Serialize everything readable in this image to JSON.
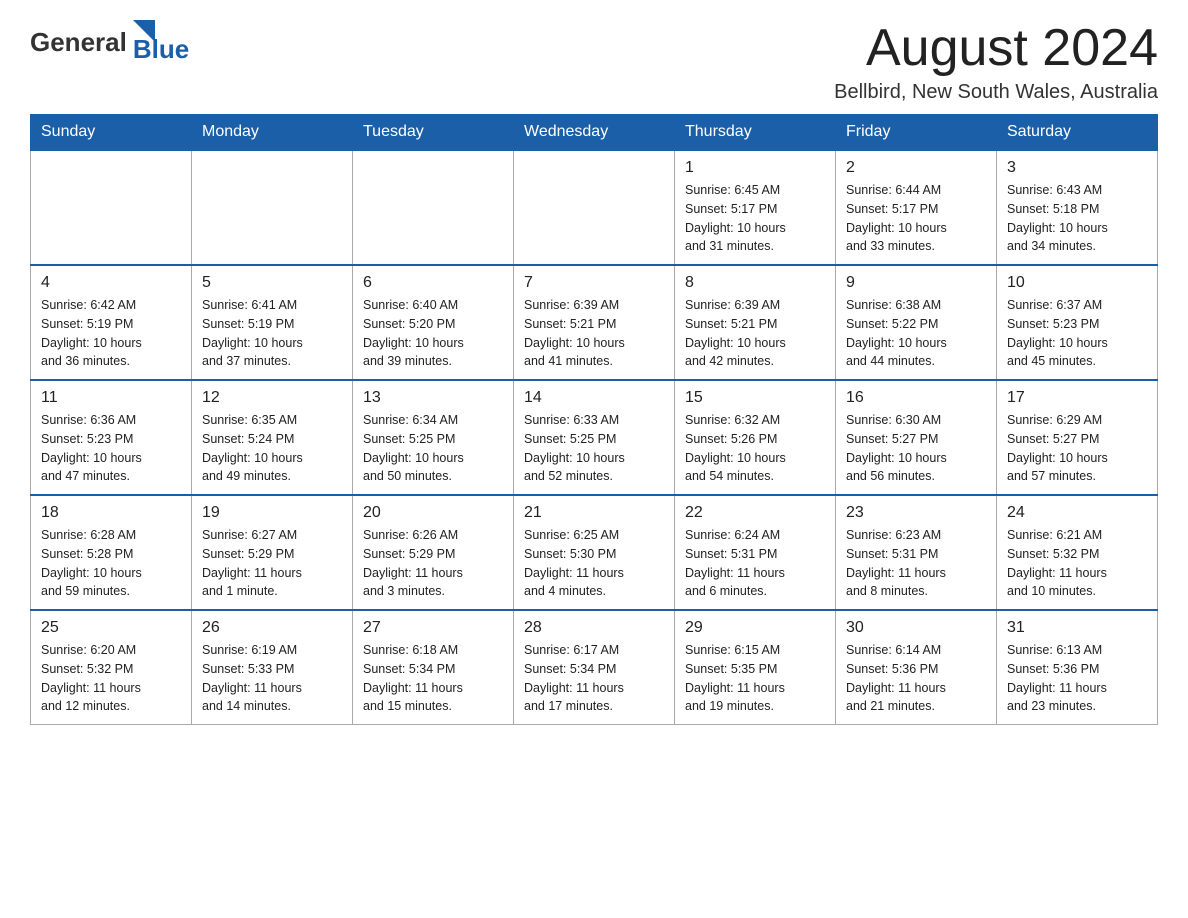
{
  "header": {
    "logo_general": "General",
    "logo_blue": "Blue",
    "month_title": "August 2024",
    "location": "Bellbird, New South Wales, Australia"
  },
  "weekdays": [
    "Sunday",
    "Monday",
    "Tuesday",
    "Wednesday",
    "Thursday",
    "Friday",
    "Saturday"
  ],
  "weeks": [
    [
      {
        "day": "",
        "info": ""
      },
      {
        "day": "",
        "info": ""
      },
      {
        "day": "",
        "info": ""
      },
      {
        "day": "",
        "info": ""
      },
      {
        "day": "1",
        "info": "Sunrise: 6:45 AM\nSunset: 5:17 PM\nDaylight: 10 hours\nand 31 minutes."
      },
      {
        "day": "2",
        "info": "Sunrise: 6:44 AM\nSunset: 5:17 PM\nDaylight: 10 hours\nand 33 minutes."
      },
      {
        "day": "3",
        "info": "Sunrise: 6:43 AM\nSunset: 5:18 PM\nDaylight: 10 hours\nand 34 minutes."
      }
    ],
    [
      {
        "day": "4",
        "info": "Sunrise: 6:42 AM\nSunset: 5:19 PM\nDaylight: 10 hours\nand 36 minutes."
      },
      {
        "day": "5",
        "info": "Sunrise: 6:41 AM\nSunset: 5:19 PM\nDaylight: 10 hours\nand 37 minutes."
      },
      {
        "day": "6",
        "info": "Sunrise: 6:40 AM\nSunset: 5:20 PM\nDaylight: 10 hours\nand 39 minutes."
      },
      {
        "day": "7",
        "info": "Sunrise: 6:39 AM\nSunset: 5:21 PM\nDaylight: 10 hours\nand 41 minutes."
      },
      {
        "day": "8",
        "info": "Sunrise: 6:39 AM\nSunset: 5:21 PM\nDaylight: 10 hours\nand 42 minutes."
      },
      {
        "day": "9",
        "info": "Sunrise: 6:38 AM\nSunset: 5:22 PM\nDaylight: 10 hours\nand 44 minutes."
      },
      {
        "day": "10",
        "info": "Sunrise: 6:37 AM\nSunset: 5:23 PM\nDaylight: 10 hours\nand 45 minutes."
      }
    ],
    [
      {
        "day": "11",
        "info": "Sunrise: 6:36 AM\nSunset: 5:23 PM\nDaylight: 10 hours\nand 47 minutes."
      },
      {
        "day": "12",
        "info": "Sunrise: 6:35 AM\nSunset: 5:24 PM\nDaylight: 10 hours\nand 49 minutes."
      },
      {
        "day": "13",
        "info": "Sunrise: 6:34 AM\nSunset: 5:25 PM\nDaylight: 10 hours\nand 50 minutes."
      },
      {
        "day": "14",
        "info": "Sunrise: 6:33 AM\nSunset: 5:25 PM\nDaylight: 10 hours\nand 52 minutes."
      },
      {
        "day": "15",
        "info": "Sunrise: 6:32 AM\nSunset: 5:26 PM\nDaylight: 10 hours\nand 54 minutes."
      },
      {
        "day": "16",
        "info": "Sunrise: 6:30 AM\nSunset: 5:27 PM\nDaylight: 10 hours\nand 56 minutes."
      },
      {
        "day": "17",
        "info": "Sunrise: 6:29 AM\nSunset: 5:27 PM\nDaylight: 10 hours\nand 57 minutes."
      }
    ],
    [
      {
        "day": "18",
        "info": "Sunrise: 6:28 AM\nSunset: 5:28 PM\nDaylight: 10 hours\nand 59 minutes."
      },
      {
        "day": "19",
        "info": "Sunrise: 6:27 AM\nSunset: 5:29 PM\nDaylight: 11 hours\nand 1 minute."
      },
      {
        "day": "20",
        "info": "Sunrise: 6:26 AM\nSunset: 5:29 PM\nDaylight: 11 hours\nand 3 minutes."
      },
      {
        "day": "21",
        "info": "Sunrise: 6:25 AM\nSunset: 5:30 PM\nDaylight: 11 hours\nand 4 minutes."
      },
      {
        "day": "22",
        "info": "Sunrise: 6:24 AM\nSunset: 5:31 PM\nDaylight: 11 hours\nand 6 minutes."
      },
      {
        "day": "23",
        "info": "Sunrise: 6:23 AM\nSunset: 5:31 PM\nDaylight: 11 hours\nand 8 minutes."
      },
      {
        "day": "24",
        "info": "Sunrise: 6:21 AM\nSunset: 5:32 PM\nDaylight: 11 hours\nand 10 minutes."
      }
    ],
    [
      {
        "day": "25",
        "info": "Sunrise: 6:20 AM\nSunset: 5:32 PM\nDaylight: 11 hours\nand 12 minutes."
      },
      {
        "day": "26",
        "info": "Sunrise: 6:19 AM\nSunset: 5:33 PM\nDaylight: 11 hours\nand 14 minutes."
      },
      {
        "day": "27",
        "info": "Sunrise: 6:18 AM\nSunset: 5:34 PM\nDaylight: 11 hours\nand 15 minutes."
      },
      {
        "day": "28",
        "info": "Sunrise: 6:17 AM\nSunset: 5:34 PM\nDaylight: 11 hours\nand 17 minutes."
      },
      {
        "day": "29",
        "info": "Sunrise: 6:15 AM\nSunset: 5:35 PM\nDaylight: 11 hours\nand 19 minutes."
      },
      {
        "day": "30",
        "info": "Sunrise: 6:14 AM\nSunset: 5:36 PM\nDaylight: 11 hours\nand 21 minutes."
      },
      {
        "day": "31",
        "info": "Sunrise: 6:13 AM\nSunset: 5:36 PM\nDaylight: 11 hours\nand 23 minutes."
      }
    ]
  ]
}
